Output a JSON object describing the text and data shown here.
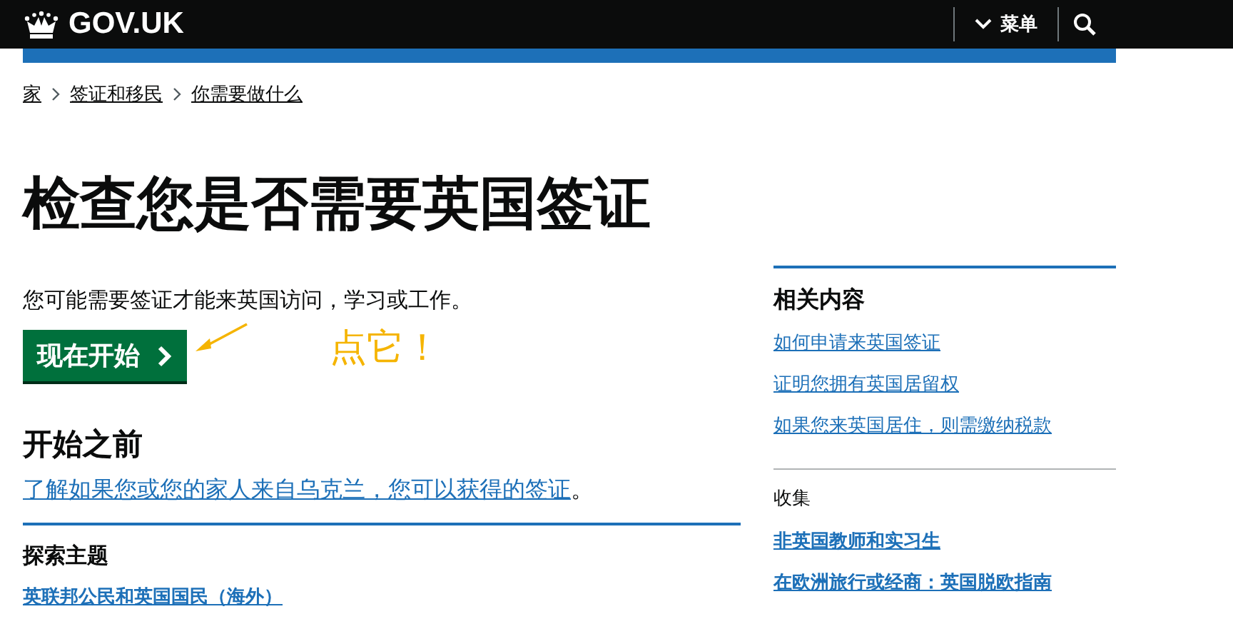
{
  "header": {
    "logo": "GOV.UK",
    "menu": "菜单"
  },
  "breadcrumbs": [
    {
      "label": "家"
    },
    {
      "label": "签证和移民"
    },
    {
      "label": "你需要做什么"
    }
  ],
  "title": "检查您是否需要英国签证",
  "intro": "您可能需要签证才能来英国访问，学习或工作。",
  "start_button": "现在开始",
  "annotation": "点它！",
  "before": {
    "heading": "开始之前",
    "link": "了解如果您或您的家人来自乌克兰，您可以获得的签证",
    "suffix": "。"
  },
  "explore": {
    "heading": "探索主题",
    "links": [
      "英联邦公民和英国国民（海外）"
    ]
  },
  "related": {
    "heading": "相关内容",
    "links": [
      "如何申请来英国签证",
      "证明您拥有英国居留权",
      "如果您来英国居住，则需缴纳税款"
    ]
  },
  "collections": {
    "heading": "收集",
    "links": [
      "非英国教师和实习生",
      "在欧洲旅行或经商：英国脱欧指南"
    ]
  }
}
